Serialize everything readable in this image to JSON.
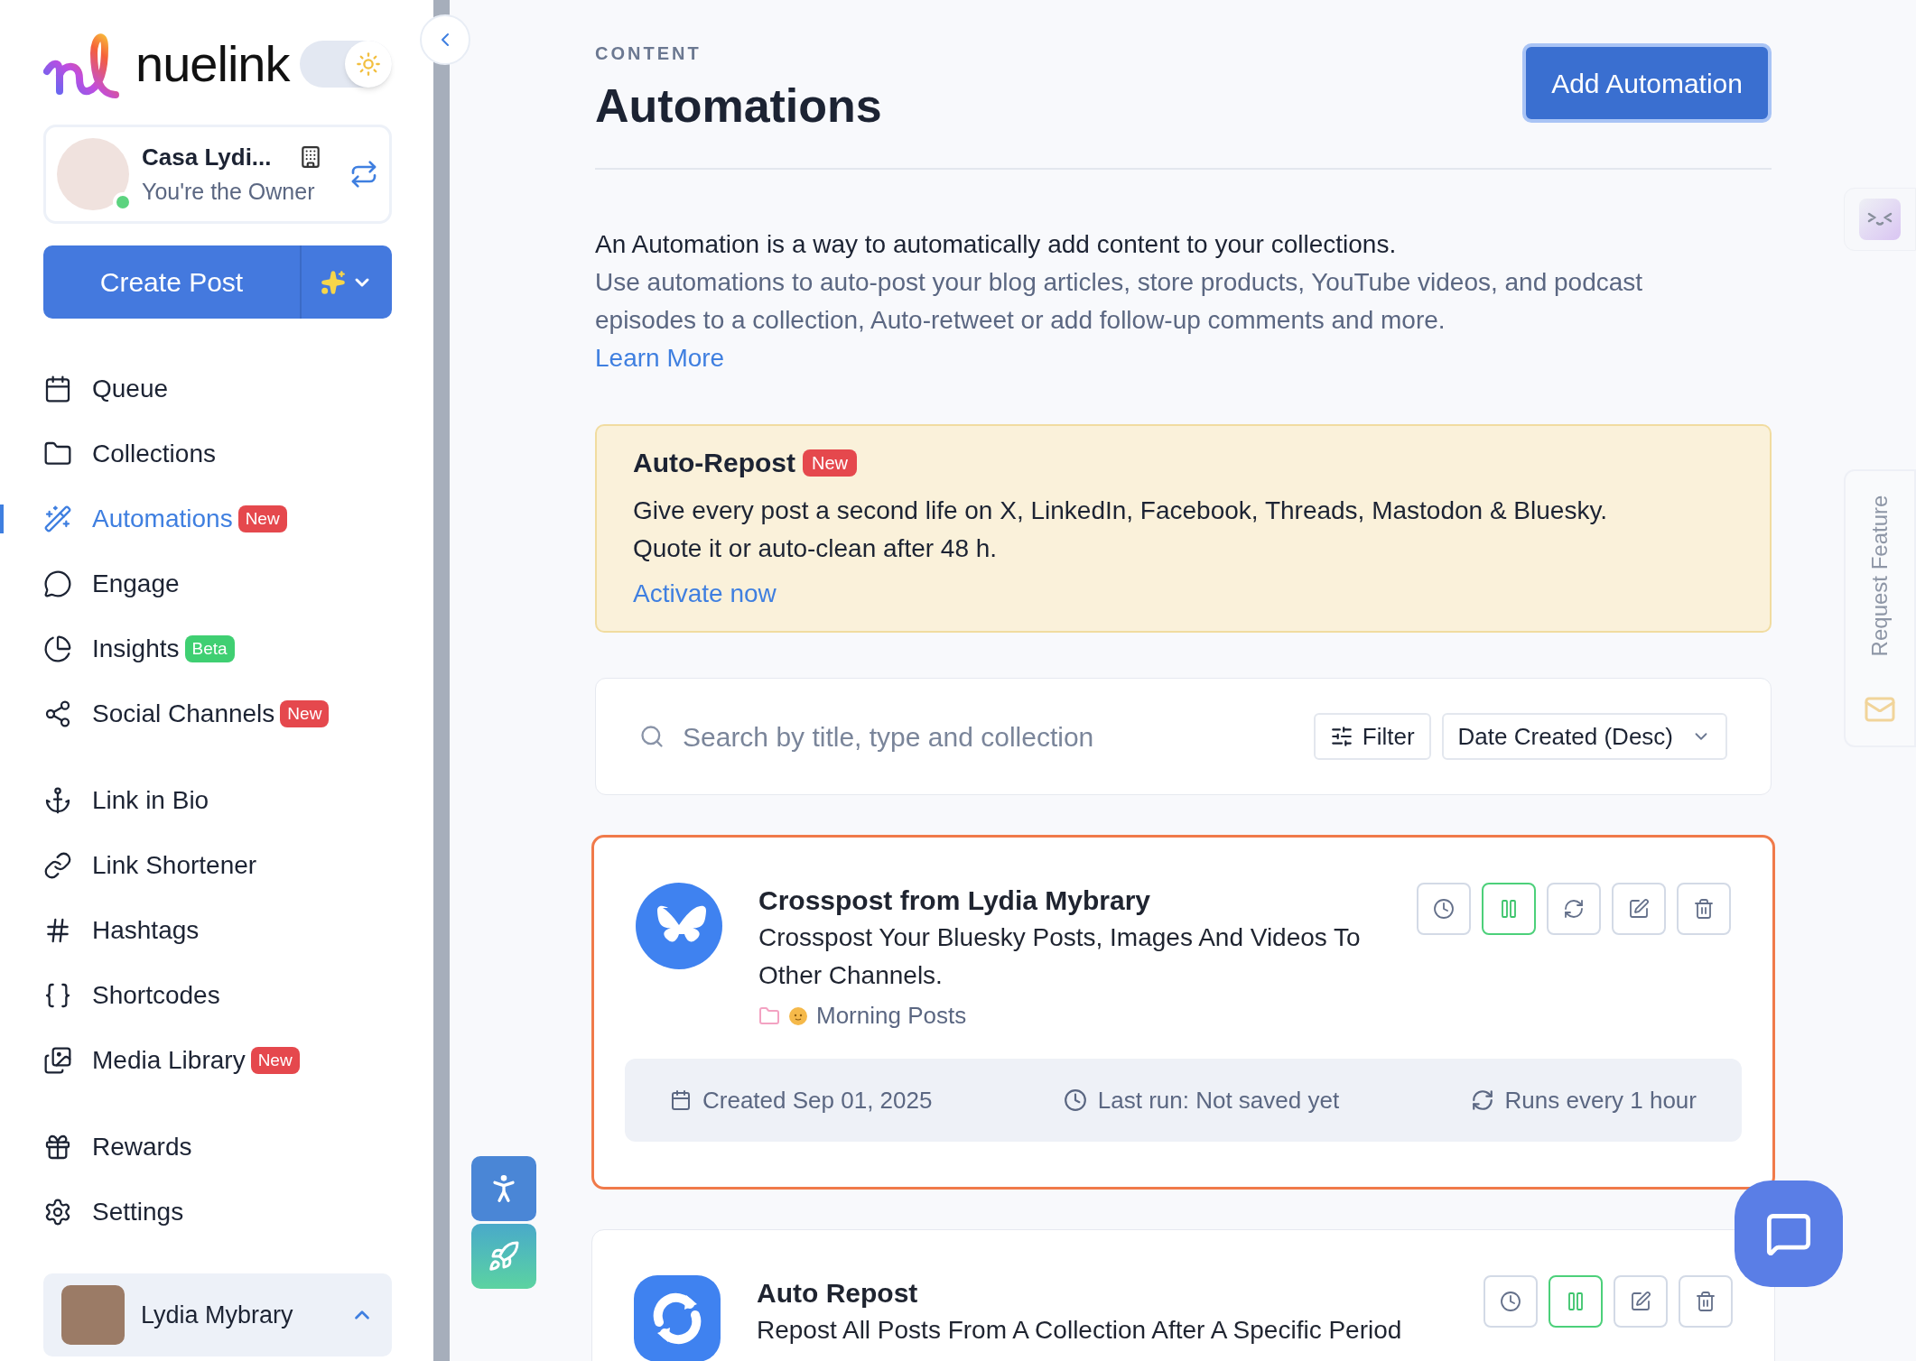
{
  "brand": {
    "name": "nuelink"
  },
  "theme_toggle": {
    "dark_mode": false
  },
  "account": {
    "name": "Casa Lydi...",
    "role": "You're the Owner",
    "online": true
  },
  "create_post": {
    "label": "Create Post"
  },
  "nav_groups": [
    [
      {
        "label": "Queue",
        "selected": false
      },
      {
        "label": "Collections",
        "selected": false
      },
      {
        "label": "Automations",
        "selected": true,
        "badge": {
          "text": "New",
          "color": "#e5484d"
        }
      },
      {
        "label": "Engage",
        "selected": false
      },
      {
        "label": "Insights",
        "selected": false,
        "badge": {
          "text": "Beta",
          "color": "#3fcf72"
        }
      },
      {
        "label": "Social Channels",
        "selected": false,
        "badge": {
          "text": "New",
          "color": "#e5484d"
        }
      }
    ],
    [
      {
        "label": "Link in Bio",
        "selected": false
      },
      {
        "label": "Link Shortener",
        "selected": false
      },
      {
        "label": "Hashtags",
        "selected": false
      },
      {
        "label": "Shortcodes",
        "selected": false
      },
      {
        "label": "Media Library",
        "selected": false,
        "badge": {
          "text": "New",
          "color": "#e5484d"
        }
      }
    ],
    [
      {
        "label": "Rewards",
        "selected": false
      },
      {
        "label": "Settings",
        "selected": false
      }
    ]
  ],
  "user": {
    "name": "Lydia Mybrary"
  },
  "header": {
    "eyebrow": "CONTENT",
    "title": "Automations",
    "button": "Add Automation"
  },
  "intro": {
    "lead": "An Automation is a way to automatically add content to your collections.",
    "body": "Use automations to auto-post your blog articles, store products, YouTube videos, and podcast episodes to a collection, Auto-retweet or add follow-up comments and more.",
    "link": "Learn More"
  },
  "promo": {
    "title": "Auto-Repost",
    "badge": "New",
    "lines": [
      "Give every post a second life on X, LinkedIn, Facebook, Threads, Mastodon & Bluesky.",
      "Quote it or auto-clean after 48 h."
    ],
    "link": "Activate now"
  },
  "search": {
    "placeholder": "Search by title, type and collection",
    "filter": "Filter",
    "sort": "Date Created (Desc)"
  },
  "automations": [
    {
      "kind": "bluesky",
      "highlighted": true,
      "title": "Crosspost from Lydia Mybrary",
      "description": "Crosspost Your Bluesky Posts, Images And Videos To Other Channels.",
      "collection": "Morning Posts",
      "actions": [
        {
          "kind": "history"
        },
        {
          "kind": "pause"
        },
        {
          "kind": "sync"
        },
        {
          "kind": "edit"
        },
        {
          "kind": "delete"
        }
      ],
      "created": "Created Sep 01, 2025",
      "last_run": "Last run: Not saved yet",
      "frequency": "Runs every 1 hour"
    },
    {
      "kind": "repost",
      "highlighted": false,
      "title": "Auto Repost",
      "description": "Repost All Posts From A Collection After A Specific Period",
      "actions": [
        {
          "kind": "history"
        },
        {
          "kind": "pause"
        },
        {
          "kind": "edit"
        },
        {
          "kind": "delete"
        }
      ]
    }
  ],
  "side_rail": {
    "request_feature": "Request Feature"
  }
}
